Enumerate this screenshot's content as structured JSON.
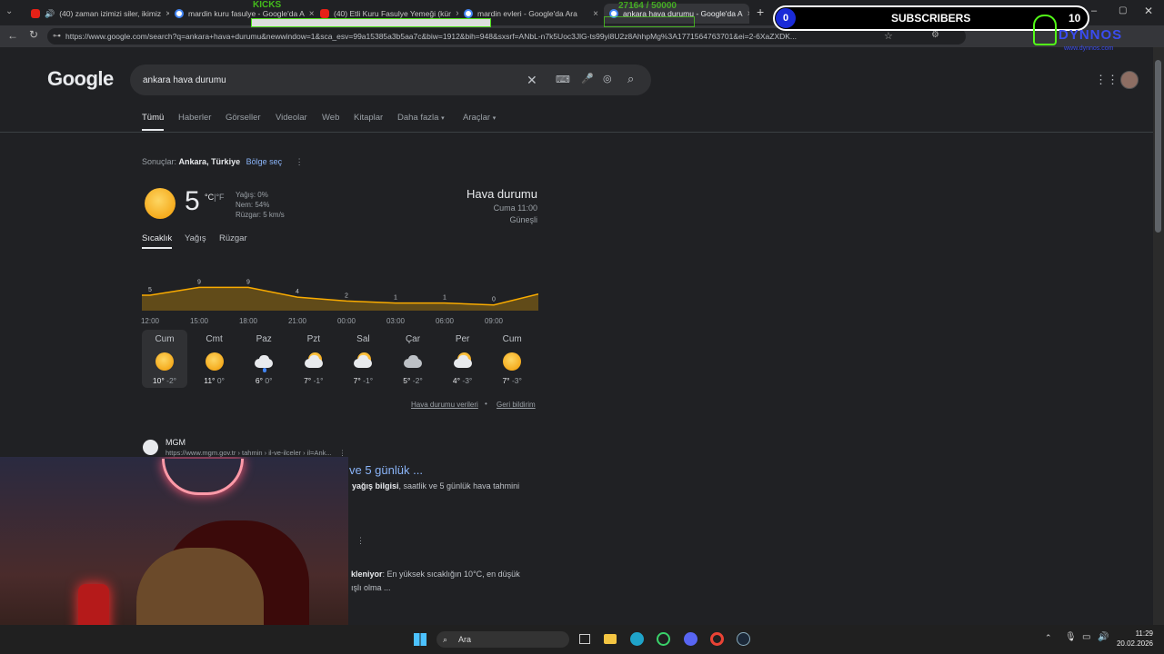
{
  "tabs": [
    {
      "title": "(40) zaman izimizi siler, ikimiz",
      "icon": "youtube-icon",
      "active": false
    },
    {
      "title": "mardin kuru fasulye - Google'da A",
      "icon": "google-icon",
      "active": false
    },
    {
      "title": "(40) Etli Kuru Fasulye Yemeği (kür",
      "icon": "youtube-icon",
      "active": false
    },
    {
      "title": "mardin evleri - Google'da Ara",
      "icon": "google-icon",
      "active": false
    },
    {
      "title": "ankara hava durumu - Google'da A",
      "icon": "google-icon",
      "active": true
    }
  ],
  "address_bar": {
    "url": "https://www.google.com/search?q=ankara+hava+durumu&newwindow=1&sca_esv=99a15385a3b5aa7c&biw=1912&bih=948&sxsrf=ANbL-n7k5Uoc3JlG-ts99yi8U2z8AhhpMg%3A1771564763701&ei=2-6XaZXDK..."
  },
  "google": {
    "logo": "Google",
    "search_query": "ankara hava durumu",
    "nav_tabs": [
      "Tümü",
      "Haberler",
      "Görseller",
      "Videolar",
      "Web",
      "Kitaplar",
      "Daha fazla",
      "Araçlar"
    ],
    "results_for_prefix": "Sonuçlar:",
    "results_for_location": "Ankara, Türkiye",
    "choose_region": "Bölge seç"
  },
  "weather": {
    "temperature": "5",
    "unit_c": "°C",
    "unit_sep": "|",
    "unit_f": "°F",
    "precipitation": "Yağış: 0%",
    "humidity": "Nem: 54%",
    "wind": "Rüzgar: 5 km/s",
    "title": "Hava durumu",
    "day_time": "Cuma 11:00",
    "condition": "Güneşli",
    "metric_tabs": [
      "Sıcaklık",
      "Yağış",
      "Rüzgar"
    ],
    "hourly_values": [
      5,
      9,
      9,
      4,
      2,
      1,
      1,
      0
    ],
    "hourly_times": [
      "12:00",
      "15:00",
      "18:00",
      "21:00",
      "00:00",
      "03:00",
      "06:00",
      "09:00"
    ],
    "forecast": [
      {
        "day": "Cum",
        "icon": "sunny",
        "high": "10°",
        "low": "-2°"
      },
      {
        "day": "Cmt",
        "icon": "sunny",
        "high": "11°",
        "low": "0°"
      },
      {
        "day": "Paz",
        "icon": "rain",
        "high": "6°",
        "low": "0°"
      },
      {
        "day": "Pzt",
        "icon": "partly-cloudy",
        "high": "7°",
        "low": "-1°"
      },
      {
        "day": "Sal",
        "icon": "partly-cloudy",
        "high": "7°",
        "low": "-1°"
      },
      {
        "day": "Çar",
        "icon": "cloudy",
        "high": "5°",
        "low": "-2°"
      },
      {
        "day": "Per",
        "icon": "partly-cloudy",
        "high": "4°",
        "low": "-3°"
      },
      {
        "day": "Cum",
        "icon": "sunny",
        "high": "7°",
        "low": "-3°"
      }
    ],
    "data_link": "Hava durumu verileri",
    "feedback_link": "Geri bildirim"
  },
  "results": [
    {
      "site": "MGM",
      "url": "https://www.mgm.gov.tr › tahmin › il-ve-ilceler › il=Ank...",
      "title_visible": "ve 5 günlük ...",
      "snippet_bold": "yağış bilgisi",
      "snippet": ", saatlik ve 5 günlük hava tahmini"
    },
    {
      "snippet_bold": "kleniyor",
      "snippet": ": En yüksek sıcaklığın 10°C, en düşük",
      "snippet2": "ışlı olma ..."
    }
  ],
  "overlay": {
    "kicks_label": "KICKS",
    "kicks_progress": "27164 / 50000",
    "subscribers_count": "0",
    "subscribers_label": "SUBSCRIBERS",
    "subscribers_goal": "10",
    "brand": "DYNNOS",
    "brand_sub": "www.dynnos.com"
  },
  "taskbar": {
    "search_label": "Ara",
    "time": "11:29",
    "date": "20.02.2026"
  },
  "colors": {
    "page_bg": "#202124",
    "link_blue": "#8ab4f8",
    "chart_fill": "#f9ab00"
  }
}
